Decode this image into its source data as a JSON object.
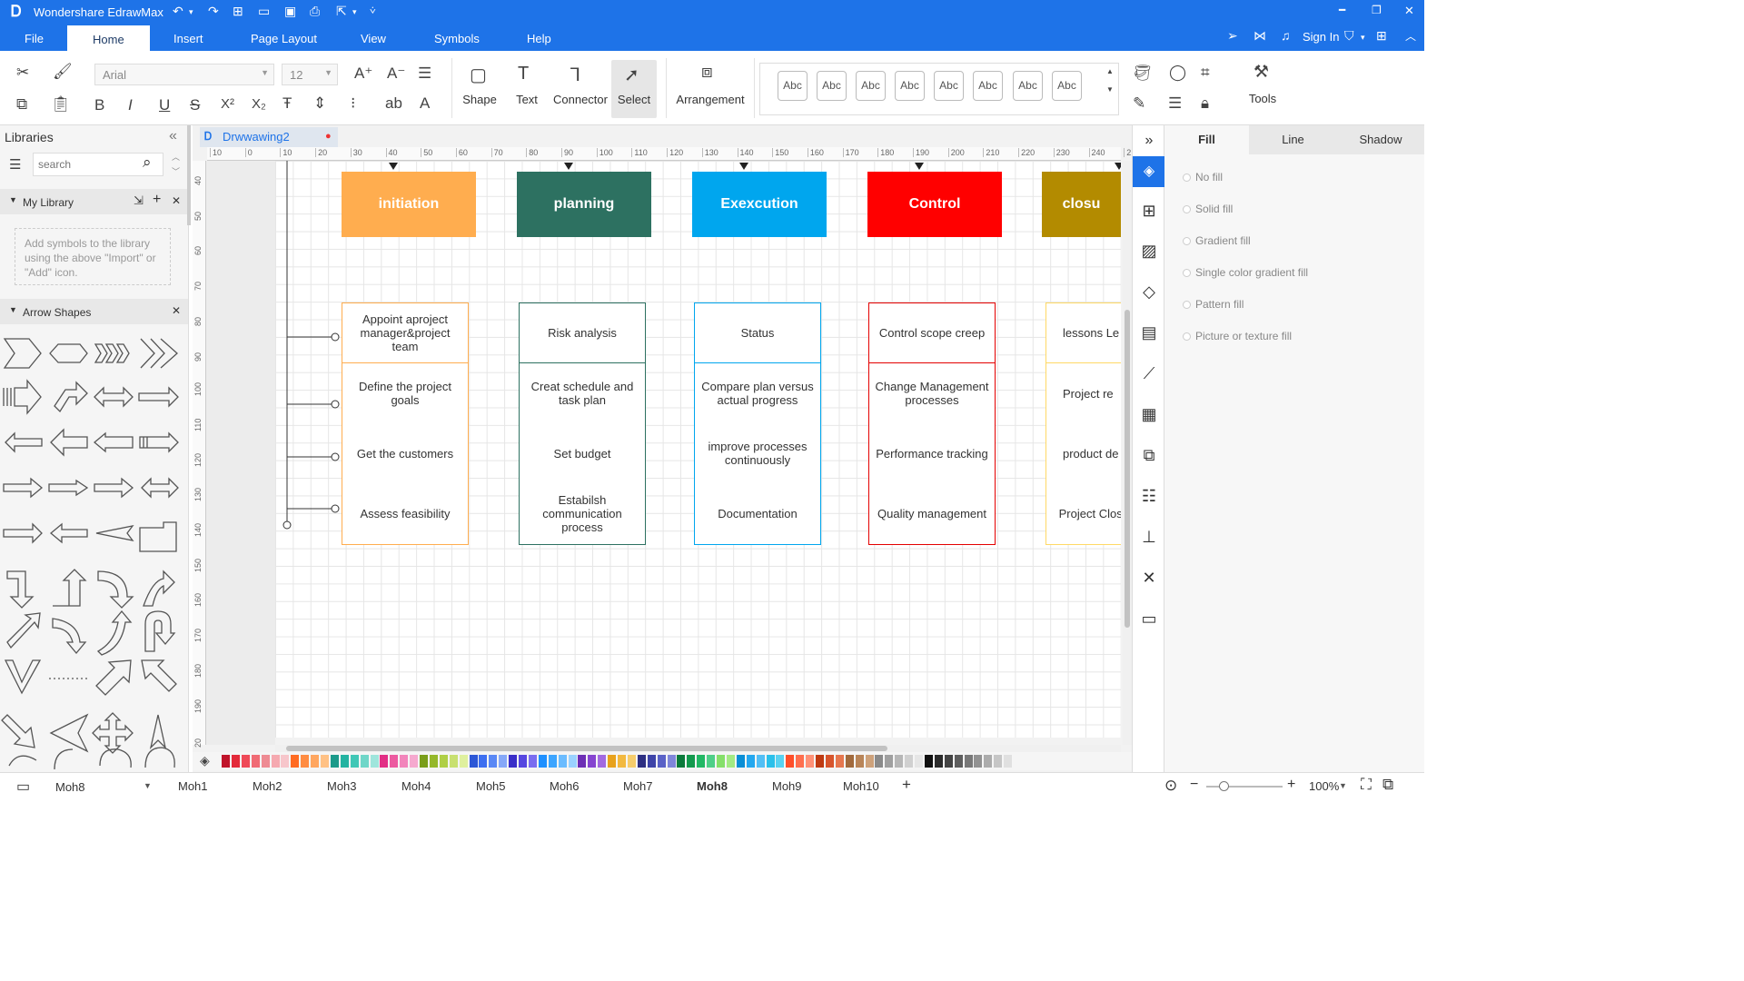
{
  "app": {
    "title": "Wondershare EdrawMax"
  },
  "menu": {
    "items": [
      "File",
      "Home",
      "Insert",
      "Page Layout",
      "View",
      "Symbols",
      "Help"
    ],
    "active": "Home"
  },
  "titlebar_right": {
    "sign_in": "Sign In"
  },
  "ribbon": {
    "font_name": "Arial",
    "font_size": "12",
    "shape_label": "Shape",
    "text_label": "Text",
    "connector_label": "Connector",
    "select_label": "Select",
    "arrangement_label": "Arrangement",
    "tools_label": "Tools",
    "style_samples": [
      "Abc",
      "Abc",
      "Abc",
      "Abc",
      "Abc",
      "Abc",
      "Abc",
      "Abc"
    ],
    "format_glyphs": [
      "B",
      "I",
      "U",
      "S",
      "X²",
      "X₂"
    ]
  },
  "libraries": {
    "title": "Libraries",
    "search_placeholder": "search",
    "my_library": "My Library",
    "empty_hint": "Add symbols to the library using the above \"Import\" or \"Add\" icon.",
    "arrow_shapes": "Arrow Shapes"
  },
  "document": {
    "tab_name": "Drwwawing2"
  },
  "ruler": {
    "h": [
      "10",
      "0",
      "10",
      "20",
      "30",
      "40",
      "50",
      "60",
      "70",
      "80",
      "90",
      "100",
      "110",
      "120",
      "130",
      "140",
      "150",
      "160",
      "170",
      "180",
      "190",
      "200",
      "210",
      "220",
      "230",
      "240",
      "2"
    ],
    "v": [
      "40",
      "50",
      "60",
      "70",
      "80",
      "90",
      "100",
      "110",
      "120",
      "130",
      "140",
      "150",
      "160",
      "170",
      "180",
      "190",
      "20"
    ]
  },
  "diagram": {
    "phases": [
      {
        "title": "initiation",
        "color": "#FFAD4F",
        "border": "#FFAD4F",
        "tasks": [
          "Appoint aproject manager&project team",
          "Define the project goals",
          "Get the customers",
          "Assess feasibility"
        ]
      },
      {
        "title": "planning",
        "color": "#2D7161",
        "border": "#2D7161",
        "tasks": [
          "Risk analysis",
          "Creat schedule and task plan",
          "Set budget",
          "Estabilsh communication process"
        ]
      },
      {
        "title": "Exexcution",
        "color": "#00A6EE",
        "border": "#00A6EE",
        "tasks": [
          "Status",
          "Compare plan versus actual progress",
          "improve processes continuously",
          "Documentation"
        ]
      },
      {
        "title": "Control",
        "color": "#FF0000",
        "border": "#E40000",
        "tasks": [
          "Control scope creep",
          "Change Management processes",
          "Performance tracking",
          "Quality management"
        ]
      },
      {
        "title": "closu",
        "color": "#B38B00",
        "border": "#FFD966",
        "tasks": [
          "lessons Le",
          "Project re",
          "product de",
          "Project Clos meetin"
        ]
      }
    ]
  },
  "properties": {
    "tabs": [
      "Fill",
      "Line",
      "Shadow"
    ],
    "active_tab": "Fill",
    "fill_options": [
      "No fill",
      "Solid fill",
      "Gradient fill",
      "Single color gradient fill",
      "Pattern fill",
      "Picture or texture fill"
    ]
  },
  "pages": {
    "current": "Moh8",
    "tabs": [
      "Moh1",
      "Moh2",
      "Moh3",
      "Moh4",
      "Moh5",
      "Moh6",
      "Moh7",
      "Moh8",
      "Moh9",
      "Moh10"
    ],
    "active": "Moh8"
  },
  "zoom": {
    "level": "100%"
  },
  "palette": [
    "#c0142b",
    "#e32a3a",
    "#ef4a58",
    "#f06b75",
    "#ee8b93",
    "#f5a9b0",
    "#f7c6cb",
    "#ff6b22",
    "#ff8c42",
    "#ffa660",
    "#ffc185",
    "#1b9a8a",
    "#23b3a1",
    "#40c7b6",
    "#6fd6c8",
    "#9fe5dc",
    "#e22e85",
    "#ec5aa0",
    "#f285bb",
    "#f6a9cf",
    "#7a9e1a",
    "#95b82a",
    "#afcf45",
    "#c8e070",
    "#dff09e",
    "#2c57d6",
    "#3d6ff0",
    "#5a88f5",
    "#86a8f8",
    "#3a2ec8",
    "#5647e0",
    "#7a6df0",
    "#1e90ff",
    "#3da5ff",
    "#6bbcff",
    "#9ad2ff",
    "#6d2fb5",
    "#8645d0",
    "#a26ae0",
    "#e8a21c",
    "#f2b940",
    "#f6cd6c",
    "#2d2f82",
    "#3e44a8",
    "#5a62c7",
    "#7f86da",
    "#0a7a3b",
    "#139a4e",
    "#22b865",
    "#4fcf88",
    "#85df6a",
    "#a3ea84",
    "#0a8fd6",
    "#24a8ef",
    "#52bff5",
    "#2bc0ea",
    "#59d2f1",
    "#ff4f2a",
    "#ff6f4f",
    "#ff9177",
    "#bf3a12",
    "#d7552d",
    "#e6774f",
    "#a26a3d",
    "#b98559",
    "#cea27b",
    "#8a8a8a",
    "#a0a0a0",
    "#b7b7b7",
    "#d0d0d0",
    "#e6e6e6",
    "#111111",
    "#2b2b2b",
    "#444444",
    "#5e5e5e",
    "#787878",
    "#929292",
    "#acacac",
    "#c6c6c6",
    "#e0e0e0"
  ]
}
